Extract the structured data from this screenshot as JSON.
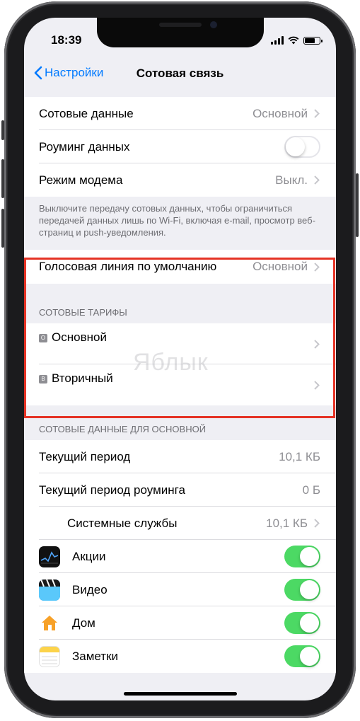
{
  "status_bar": {
    "time": "18:39",
    "signal_bars": 4,
    "battery_level": 0.8
  },
  "nav": {
    "back_label": "Настройки",
    "title": "Сотовая связь"
  },
  "group1": {
    "cellular_data": {
      "label": "Сотовые данные",
      "value": "Основной"
    },
    "data_roaming": {
      "label": "Роуминг данных",
      "enabled": false
    },
    "hotspot": {
      "label": "Режим модема",
      "value": "Выкл."
    }
  },
  "footnote": "Выключите передачу сотовых данных, чтобы ограничиться передачей данных лишь по Wi-Fi, включая e-mail, просмотр веб-страниц и push-уведомления.",
  "default_voice": {
    "label": "Голосовая линия по умолчанию",
    "value": "Основной"
  },
  "plans": {
    "header": "Сотовые тарифы",
    "items": [
      {
        "badge": "O",
        "label": "Основной"
      },
      {
        "badge": "B",
        "label": "Вторичный"
      }
    ]
  },
  "usage": {
    "header": "Сотовые данные для основной",
    "current_period": {
      "label": "Текущий период",
      "value": "10,1 КБ"
    },
    "roaming_period": {
      "label": "Текущий период роуминга",
      "value": "0 Б"
    },
    "system_services": {
      "label": "Системные службы",
      "value": "10,1 КБ"
    },
    "apps": [
      {
        "name": "Акции",
        "icon": "stocks-icon",
        "enabled": true
      },
      {
        "name": "Видео",
        "icon": "video-icon",
        "enabled": true
      },
      {
        "name": "Дом",
        "icon": "home-icon",
        "enabled": true
      },
      {
        "name": "Заметки",
        "icon": "notes-icon",
        "enabled": true
      }
    ]
  },
  "watermark": "Яблык",
  "colors": {
    "accent": "#007aff",
    "toggle_on": "#4cd964",
    "highlight": "#e53325"
  }
}
